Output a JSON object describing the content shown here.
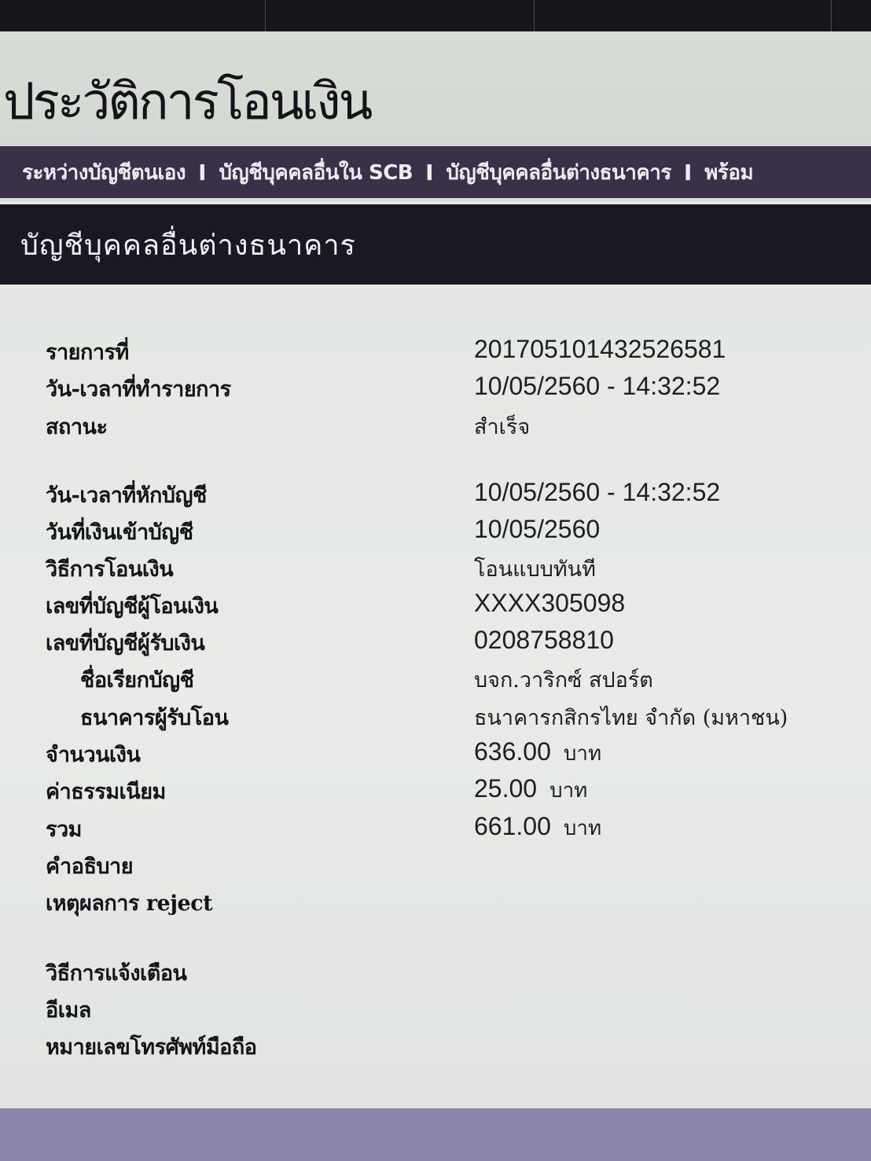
{
  "top_nav": {
    "tabs": [
      "",
      "",
      "",
      ""
    ]
  },
  "page": {
    "title": "ประวัติการโอนเงิน"
  },
  "sub_nav": {
    "items": [
      "ระหว่างบัญชีตนเอง",
      "บัญชีบุคคลอื่นใน SCB",
      "บัญชีบุคคลอื่นต่างธนาคาร",
      "พร้อม"
    ],
    "separator": "I"
  },
  "section": {
    "title": "บัญชีบุคคลอื่นต่างธนาคาร"
  },
  "details": {
    "transaction_no_label": "รายการที่",
    "transaction_no": "201705101432526581",
    "transaction_datetime_label": "วัน-เวลาที่ทำรายการ",
    "transaction_datetime": "10/05/2560 - 14:32:52",
    "status_label": "สถานะ",
    "status": "สำเร็จ",
    "debit_datetime_label": "วัน-เวลาที่หักบัญชี",
    "debit_datetime": "10/05/2560 - 14:32:52",
    "credit_date_label": "วันที่เงินเข้าบัญชี",
    "credit_date": "10/05/2560",
    "transfer_method_label": "วิธีการโอนเงิน",
    "transfer_method": "โอนแบบทันที",
    "sender_account_label": "เลขที่บัญชีผู้โอนเงิน",
    "sender_account": "XXXX305098",
    "receiver_account_label": "เลขที่บัญชีผู้รับเงิน",
    "receiver_account": "0208758810",
    "account_name_label": "ชื่อเรียกบัญชี",
    "account_name": "บจก.วาริกซ์ สปอร์ต",
    "receiver_bank_label": "ธนาคารผู้รับโอน",
    "receiver_bank": "ธนาคารกสิกรไทย จำกัด (มหาชน)",
    "amount_label": "จำนวนเงิน",
    "amount": "636.00",
    "fee_label": "ค่าธรรมเนียม",
    "fee": "25.00",
    "total_label": "รวม",
    "total": "661.00",
    "currency": "บาท",
    "description_label": "คำอธิบาย",
    "reject_reason_label": "เหตุผลการ reject",
    "notify_method_label": "วิธีการแจ้งเตือน",
    "email_label": "อีเมล",
    "mobile_label": "หมายเลขโทรศัพท์มือถือ"
  }
}
